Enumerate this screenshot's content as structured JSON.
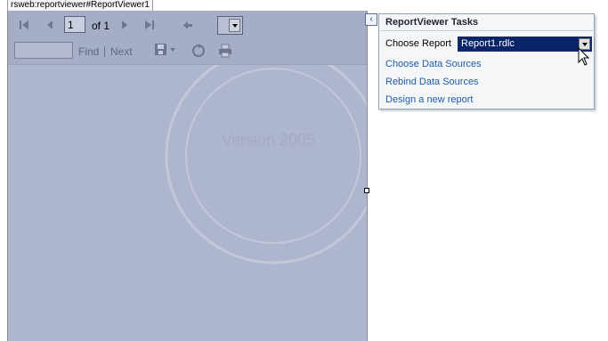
{
  "tag_label": "rsweb:reportviewer#ReportViewer1",
  "viewer": {
    "page_number": "1",
    "page_of": "of 1",
    "find_label": "Find",
    "find_separator": "|",
    "next_label": "Next",
    "watermark_lines": [
      "Version 2005"
    ],
    "icons": [
      "first-page-icon",
      "previous-page-icon",
      "next-page-icon",
      "last-page-icon",
      "back-icon",
      "export-icon",
      "refresh-icon",
      "print-icon"
    ]
  },
  "tasks_panel": {
    "title": "ReportViewer Tasks",
    "choose_report_label": "Choose Report",
    "selected_report": "Report1.rdlc",
    "links": [
      "Choose Data Sources",
      "Rebind Data Sources",
      "Design a new report"
    ]
  },
  "colors": {
    "viewer_background": "#aeb6cf",
    "selection": "#0a246a",
    "link": "#1e5ca8"
  }
}
